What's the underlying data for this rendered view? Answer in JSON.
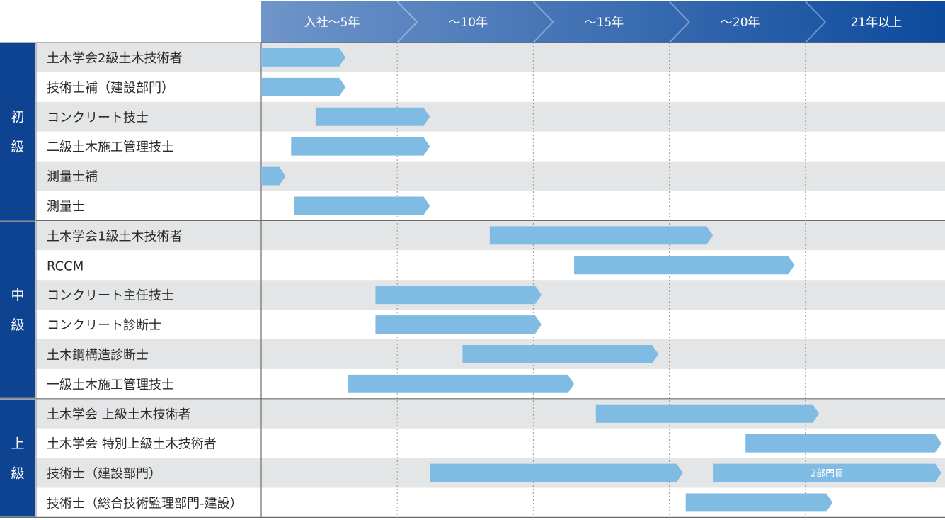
{
  "chart_data": {
    "type": "gantt",
    "periods": [
      "入社〜5年",
      "〜10年",
      "〜15年",
      "〜20年",
      "21年以上"
    ],
    "groups": [
      {
        "label": "初級",
        "chars": [
          "初",
          "級"
        ],
        "rows": [
          0,
          5
        ]
      },
      {
        "label": "中級",
        "chars": [
          "中",
          "級"
        ],
        "rows": [
          6,
          11
        ]
      },
      {
        "label": "上級",
        "chars": [
          "上",
          "級"
        ],
        "rows": [
          12,
          15
        ]
      }
    ],
    "rows": [
      {
        "label": "土木学会2級土木技術者",
        "bars": [
          {
            "start": 0.0,
            "end": 3.1
          }
        ]
      },
      {
        "label": "技術士補（建設部門）",
        "bars": [
          {
            "start": 0.0,
            "end": 3.1
          }
        ]
      },
      {
        "label": "コンクリート技士",
        "bars": [
          {
            "start": 2.0,
            "end": 6.2
          }
        ]
      },
      {
        "label": "二級土木施工管理技士",
        "bars": [
          {
            "start": 1.1,
            "end": 6.2
          }
        ]
      },
      {
        "label": "測量士補",
        "bars": [
          {
            "start": 0.0,
            "end": 0.9
          }
        ]
      },
      {
        "label": "測量士",
        "bars": [
          {
            "start": 1.2,
            "end": 6.2
          }
        ]
      },
      {
        "label": "土木学会1級土木技術者",
        "bars": [
          {
            "start": 8.4,
            "end": 16.6
          }
        ]
      },
      {
        "label": "RCCM",
        "bars": [
          {
            "start": 11.5,
            "end": 19.6
          }
        ]
      },
      {
        "label": "コンクリート主任技士",
        "bars": [
          {
            "start": 4.2,
            "end": 10.3
          }
        ]
      },
      {
        "label": "コンクリート診断士",
        "bars": [
          {
            "start": 4.2,
            "end": 10.3
          }
        ]
      },
      {
        "label": "土木鋼構造診断士",
        "bars": [
          {
            "start": 7.4,
            "end": 14.6
          }
        ]
      },
      {
        "label": "一級土木施工管理技士",
        "bars": [
          {
            "start": 3.2,
            "end": 11.5
          }
        ]
      },
      {
        "label": "土木学会 上級土木技術者",
        "bars": [
          {
            "start": 12.3,
            "end": 20.5
          }
        ]
      },
      {
        "label": "土木学会 特別上級土木技術者",
        "bars": [
          {
            "start": 17.8,
            "end": 25.0
          }
        ]
      },
      {
        "label": "技術士（建設部門）",
        "bars": [
          {
            "start": 6.2,
            "end": 15.5
          },
          {
            "start": 16.6,
            "end": 25.0,
            "label": "2部門目"
          }
        ]
      },
      {
        "label": "技術士（総合技術監理部門-建設）",
        "bars": [
          {
            "start": 15.6,
            "end": 21.0
          }
        ]
      }
    ],
    "colors": {
      "header_start": "#6f95c9",
      "header_end": "#0d4a9c",
      "group_bg": "#0d4391",
      "bar": "#7fbbe3",
      "row_shaded": "#e4e5e6",
      "row_plain": "#ffffff",
      "grid": "#9b9b9b"
    }
  }
}
